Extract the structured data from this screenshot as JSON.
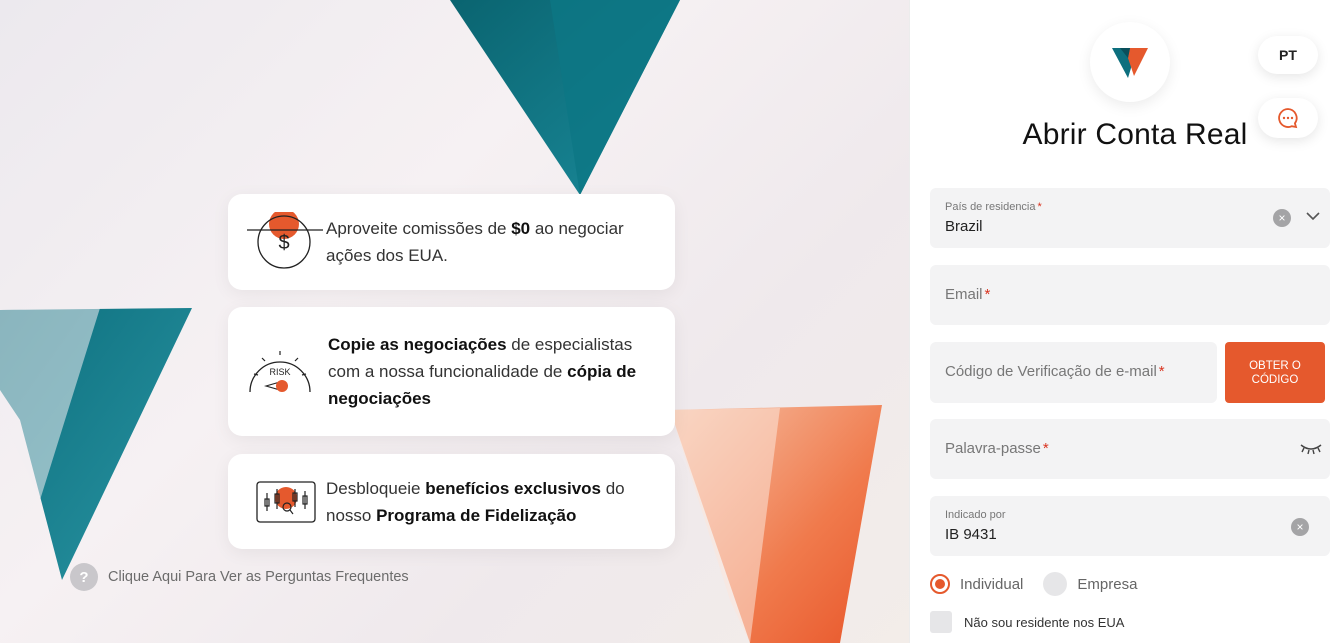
{
  "promo": {
    "card1": {
      "pre": "Aproveite comissões de ",
      "bold": "$0",
      "post": " ao negociar ações dos EUA."
    },
    "card2": {
      "bold1": "Copie as negociações",
      "mid": " de especialistas com a nossa funcionalidade de ",
      "bold2": "cópia de negociações"
    },
    "card3": {
      "pre": "Desbloqueie ",
      "bold1": "benefícios exclusivos",
      "mid": " do nosso ",
      "bold2": "Programa de Fidelização"
    },
    "risk_label": "RISK",
    "faq_icon": "?",
    "faq_text": "Clique Aqui Para Ver as Perguntas Frequentes"
  },
  "header": {
    "lang": "PT",
    "title": "Abrir Conta Real"
  },
  "form": {
    "country": {
      "label": "País de residencia",
      "required": "*",
      "value": "Brazil"
    },
    "email": {
      "label": "Email",
      "required": "*"
    },
    "code": {
      "label": "Código de Verificação de e-mail",
      "required": "*",
      "button": "OBTER O CÓDIGO"
    },
    "password": {
      "label": "Palavra-passe",
      "required": "*"
    },
    "referral": {
      "label": "Indicado por",
      "value": "IB 9431"
    },
    "account_type": {
      "individual": "Individual",
      "company": "Empresa",
      "selected": "Individual"
    },
    "non_us": {
      "label": "Não sou residente nos EUA",
      "checked": false
    }
  },
  "colors": {
    "accent": "#e5592d",
    "teal": "#0d6f7e"
  },
  "icons": {
    "clear": "×",
    "chevron": "chevron-down-icon",
    "eye": "eye-closed-icon",
    "chat": "chat-icon"
  }
}
